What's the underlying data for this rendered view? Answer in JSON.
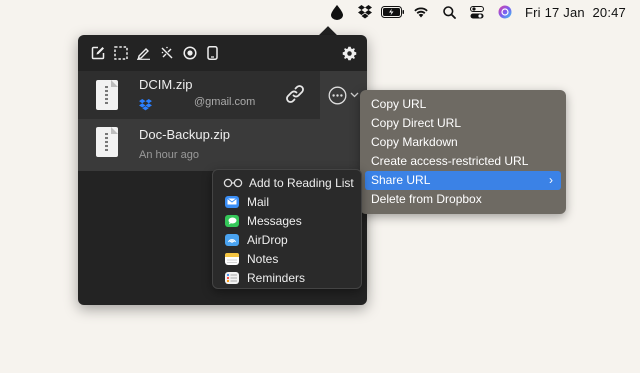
{
  "menubar": {
    "date": "Fri 17 Jan",
    "time": "20:47",
    "icons": [
      "app-drop-icon",
      "dropbox-icon",
      "battery-icon",
      "wifi-icon",
      "search-icon",
      "control-center-icon",
      "siri-icon"
    ]
  },
  "toolbar": {
    "icons": [
      "edit-icon",
      "select-region-icon",
      "annotate-icon",
      "magic-icon",
      "record-icon",
      "device-icon"
    ],
    "settings_icon": "gear-icon"
  },
  "files": [
    {
      "name": "DCIM.zip",
      "subtitle_email": "@gmail.com"
    },
    {
      "name": "Doc-Backup.zip",
      "subtitle": "An hour ago"
    }
  ],
  "context_menu": {
    "items": [
      {
        "label": "Copy URL"
      },
      {
        "label": "Copy Direct URL"
      },
      {
        "label": "Copy Markdown"
      },
      {
        "label": "Create access-restricted URL"
      },
      {
        "label": "Share URL",
        "chevron": "›"
      },
      {
        "label": "Delete from Dropbox"
      }
    ]
  },
  "share_menu": {
    "items": [
      {
        "label": "Add to Reading List",
        "icon": "reading-list-icon"
      },
      {
        "label": "Mail",
        "icon": "mail-icon",
        "color": "#3a8ef6"
      },
      {
        "label": "Messages",
        "icon": "messages-icon",
        "color": "#34c759"
      },
      {
        "label": "AirDrop",
        "icon": "airdrop-icon",
        "color": "#4aa3f0"
      },
      {
        "label": "Notes",
        "icon": "notes-icon",
        "color": "#f5c542"
      },
      {
        "label": "Reminders",
        "icon": "reminders-icon",
        "color": "#f2f2f2"
      }
    ]
  },
  "colors": {
    "accent": "#3b82e6",
    "panel": "#232323",
    "context_menu": "#6e6a63"
  }
}
